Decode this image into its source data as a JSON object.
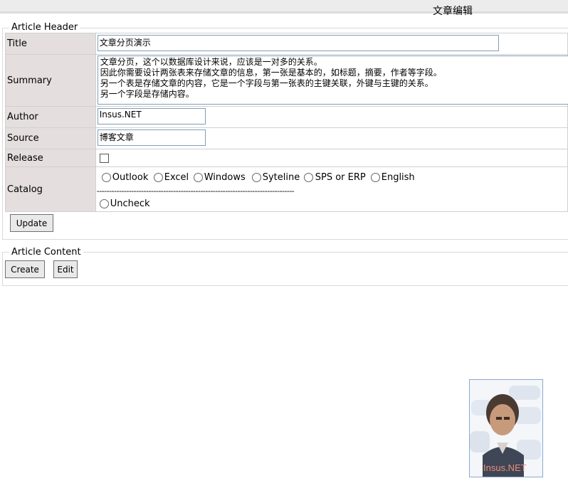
{
  "page": {
    "title": "文章编辑"
  },
  "header_section": {
    "legend": "Article Header",
    "fields": {
      "title_label": "Title",
      "title_value": "文章分页演示",
      "summary_label": "Summary",
      "summary_value": "文章分页，这个以数据库设计来说，应该是一对多的关系。\n因此你需要设计两张表来存储文章的信息，第一张是基本的，如标题，摘要，作者等字段。\n另一个表是存储文章的内容，它是一个字段与第一张表的主键关联，外键与主键的关系。\n另一个字段是存储内容。",
      "author_label": "Author",
      "author_value": "Insus.NET",
      "source_label": "Source",
      "source_value": "博客文章",
      "release_label": "Release",
      "catalog_label": "Catalog"
    },
    "catalog_options": [
      "Outlook",
      "Excel",
      "Windows",
      "Syteline",
      "SPS or ERP",
      "English"
    ],
    "separator": "--------------------------------------------------------------------------------",
    "uncheck_label": "Uncheck",
    "update_button": "Update"
  },
  "content_section": {
    "legend": "Article Content",
    "create_button": "Create",
    "edit_button": "Edit"
  },
  "avatar": {
    "caption": "Insus.NET"
  }
}
